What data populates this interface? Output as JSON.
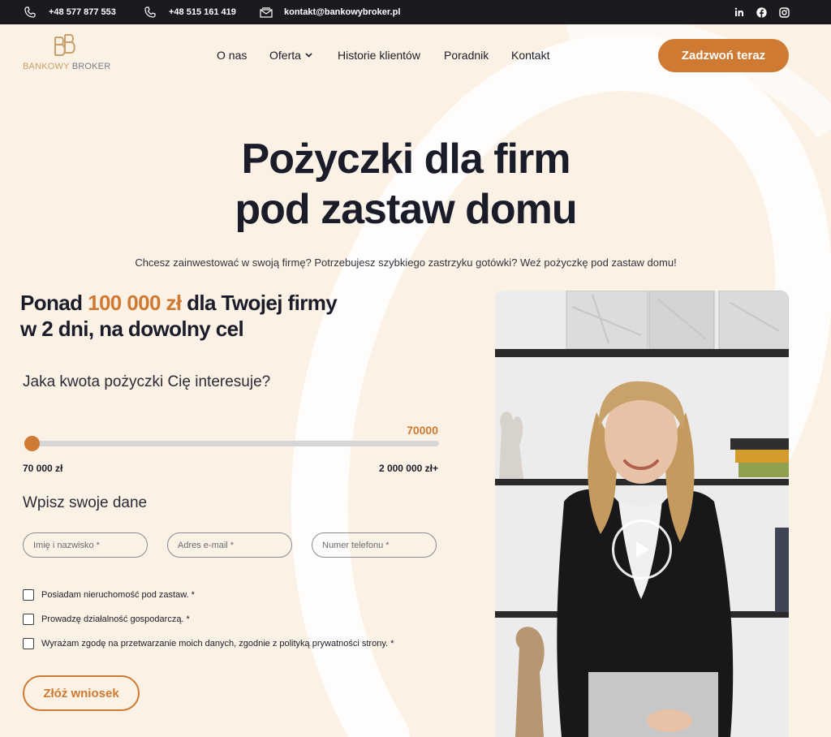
{
  "topbar": {
    "phone1": "+48 577 877 553",
    "phone2": "+48 515 161 419",
    "email": "kontakt@bankowybroker.pl",
    "social": [
      "linkedin-icon",
      "facebook-icon",
      "instagram-icon"
    ]
  },
  "logo": {
    "part1": "BANKOWY",
    "part2": "BROKER"
  },
  "nav": {
    "items": [
      "O nas",
      "Oferta",
      "Historie klientów",
      "Poradnik",
      "Kontakt"
    ],
    "cta": "Zadzwoń teraz"
  },
  "hero": {
    "title_line1": "Pożyczki dla firm",
    "title_line2": "pod zastaw domu",
    "subtitle": "Chcesz zainwestować w swoją firmę? Potrzebujesz szybkiego zastrzyku gotówki? Weź pożyczkę pod zastaw domu!"
  },
  "lead": {
    "prefix": "Ponad ",
    "amount": "100 000 zł",
    "suffix": " dla Twojej firmy",
    "line2": "w 2 dni, na dowolny cel"
  },
  "form": {
    "amount_question": "Jaka kwota pożyczki Cię interesuje?",
    "slider": {
      "value": "70000",
      "min_label": "70 000 zł",
      "max_label": "2 000 000 zł+",
      "fill_fraction": 0
    },
    "data_heading": "Wpisz swoje dane",
    "fields": {
      "name_placeholder": "Imię i nazwisko *",
      "email_placeholder": "Adres e-mail *",
      "phone_placeholder": "Numer telefonu *"
    },
    "checkboxes": [
      "Posiadam nieruchomość pod zastaw. *",
      "Prowadzę działalność gospodarczą. *",
      "Wyrażam zgodę na przetwarzanie moich danych, zgodnie z polityką prywatności strony. *"
    ],
    "submit": "Złóż wniosek"
  },
  "colors": {
    "accent": "#cf7a33",
    "background": "#fbf1e4",
    "topbar": "#1b1b1f",
    "heading": "#1a1c2a"
  }
}
